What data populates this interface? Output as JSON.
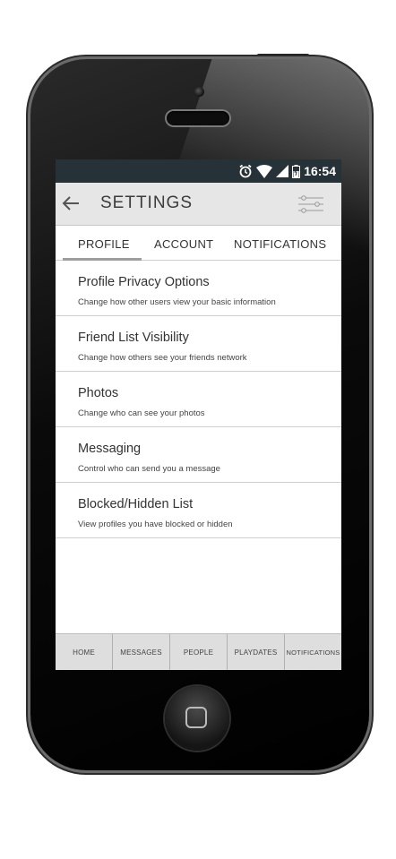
{
  "status_bar": {
    "time": "16:54"
  },
  "header": {
    "title": "SETTINGS"
  },
  "tabs": [
    {
      "label": "PROFILE",
      "active": true
    },
    {
      "label": "ACCOUNT"
    },
    {
      "label": "NOTIFICATIONS"
    }
  ],
  "settings_list": [
    {
      "title": "Profile Privacy Options",
      "subtitle": "Change how other users view your basic information"
    },
    {
      "title": "Friend List Visibility",
      "subtitle": "Change how others see your friends network"
    },
    {
      "title": "Photos",
      "subtitle": "Change who can see your photos"
    },
    {
      "title": "Messaging",
      "subtitle": "Control who can send you a message"
    },
    {
      "title": "Blocked/Hidden List",
      "subtitle": "View profiles you have blocked or hidden"
    }
  ],
  "bottom_nav": [
    "HOME",
    "MESSAGES",
    "PEOPLE",
    "PLAYDATES",
    "NOTIFICATIONS"
  ],
  "colors": {
    "status_bar": "#263238",
    "title_bar": "#e6e6e6",
    "nav_bar": "#dedede",
    "tab_indicator": "#9e9e9e"
  }
}
